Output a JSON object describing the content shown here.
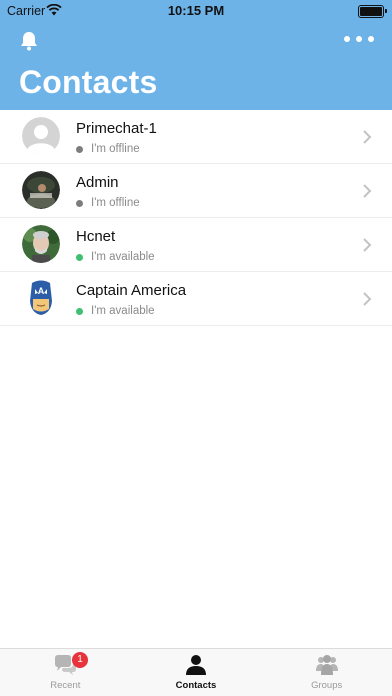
{
  "status_bar": {
    "carrier": "Carrier",
    "time": "10:15 PM"
  },
  "header": {
    "title": "Contacts",
    "bell_icon": "bell-icon",
    "more_icon": "more-dots-icon"
  },
  "contacts": [
    {
      "name": "Primechat-1",
      "status": "I'm offline",
      "status_color": "#7d7d7d",
      "avatar": "default"
    },
    {
      "name": "Admin",
      "status": "I'm offline",
      "status_color": "#7d7d7d",
      "avatar": "photo-dark"
    },
    {
      "name": "Hcnet",
      "status": "I'm available",
      "status_color": "#3fbf72",
      "avatar": "photo-man"
    },
    {
      "name": "Captain America",
      "status": "I'm available",
      "status_color": "#3fbf72",
      "avatar": "captain"
    }
  ],
  "tabs": [
    {
      "label": "Recent",
      "icon": "chat-bubbles-icon",
      "badge": "1"
    },
    {
      "label": "Contacts",
      "icon": "person-icon"
    },
    {
      "label": "Groups",
      "icon": "group-icon"
    }
  ],
  "colors": {
    "header": "#6db3e8",
    "available": "#3fbf72",
    "offline": "#7d7d7d",
    "badge": "#e8333a"
  }
}
